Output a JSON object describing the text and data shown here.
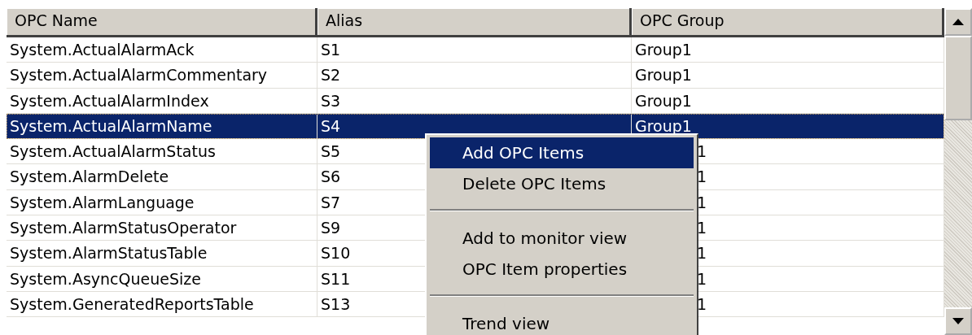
{
  "table": {
    "columns": [
      "OPC Name",
      "Alias",
      "OPC Group"
    ],
    "rows": [
      {
        "name": "System.ActualAlarmAck",
        "alias": "S1",
        "group": "Group1",
        "selected": false,
        "group_partly_hidden": false
      },
      {
        "name": "System.ActualAlarmCommentary",
        "alias": "S2",
        "group": "Group1",
        "selected": false,
        "group_partly_hidden": false
      },
      {
        "name": "System.ActualAlarmIndex",
        "alias": "S3",
        "group": "Group1",
        "selected": false,
        "group_partly_hidden": false
      },
      {
        "name": "System.ActualAlarmName",
        "alias": "S4",
        "group": "Group1",
        "selected": true,
        "group_partly_hidden": false
      },
      {
        "name": "System.ActualAlarmStatus",
        "alias": "S5",
        "group": "1",
        "selected": false,
        "group_partly_hidden": true
      },
      {
        "name": "System.AlarmDelete",
        "alias": "S6",
        "group": "1",
        "selected": false,
        "group_partly_hidden": true
      },
      {
        "name": "System.AlarmLanguage",
        "alias": "S7",
        "group": "1",
        "selected": false,
        "group_partly_hidden": true
      },
      {
        "name": "System.AlarmStatusOperator",
        "alias": "S9",
        "group": "1",
        "selected": false,
        "group_partly_hidden": true
      },
      {
        "name": "System.AlarmStatusTable",
        "alias": "S10",
        "group": "1",
        "selected": false,
        "group_partly_hidden": true
      },
      {
        "name": "System.AsyncQueueSize",
        "alias": "S11",
        "group": "1",
        "selected": false,
        "group_partly_hidden": true
      },
      {
        "name": "System.GeneratedReportsTable",
        "alias": "S13",
        "group": "1",
        "selected": false,
        "group_partly_hidden": true
      }
    ]
  },
  "context_menu": {
    "items": [
      {
        "kind": "item",
        "label": "Add OPC Items",
        "selected": true
      },
      {
        "kind": "item",
        "label": "Delete OPC Items",
        "selected": false
      },
      {
        "kind": "separator"
      },
      {
        "kind": "item",
        "label": "Add to monitor view",
        "selected": false
      },
      {
        "kind": "item",
        "label": "OPC Item properties",
        "selected": false
      },
      {
        "kind": "separator"
      },
      {
        "kind": "item",
        "label": "Trend view",
        "selected": false
      }
    ]
  }
}
